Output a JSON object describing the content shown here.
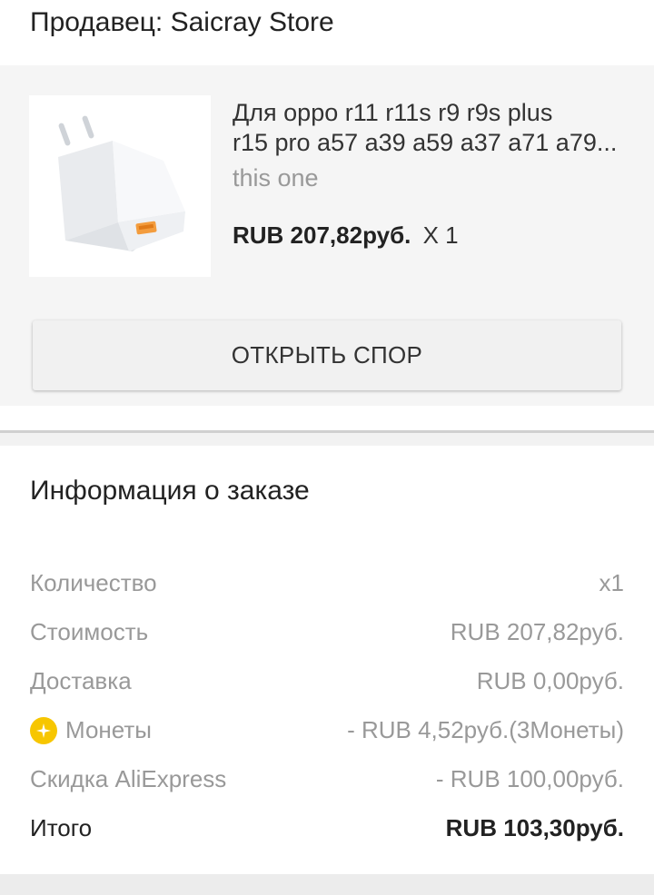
{
  "seller": {
    "title": "Продавец: Saicray Store"
  },
  "product": {
    "name_line1": "Для oppo r11 r11s r9 r9s plus",
    "name_line2": "r15 pro a57 a39 a59 a37 a71 a79...",
    "variant": "this one",
    "price": "RUB 207,82руб.",
    "quantity": "X 1",
    "image_icon": "usb-charger-image"
  },
  "dispute_button": {
    "label": "ОТКРЫТЬ СПОР"
  },
  "order_info": {
    "title": "Информация о заказе",
    "rows": [
      {
        "label": "Количество",
        "value": "x1"
      },
      {
        "label": "Стоимость",
        "value": "RUB 207,82руб."
      },
      {
        "label": "Доставка",
        "value": "RUB 0,00руб."
      },
      {
        "label": "Монеты",
        "value": "- RUB 4,52руб.(3Монеты)",
        "icon": "coin-icon"
      },
      {
        "label": "Скидка AliExpress",
        "value": "- RUB 100,00руб."
      },
      {
        "label": "Итого",
        "value": "RUB 103,30руб."
      }
    ]
  },
  "colors": {
    "coin": "#f7c600",
    "muted_text": "#999999",
    "section_bg": "#f5f5f5"
  }
}
